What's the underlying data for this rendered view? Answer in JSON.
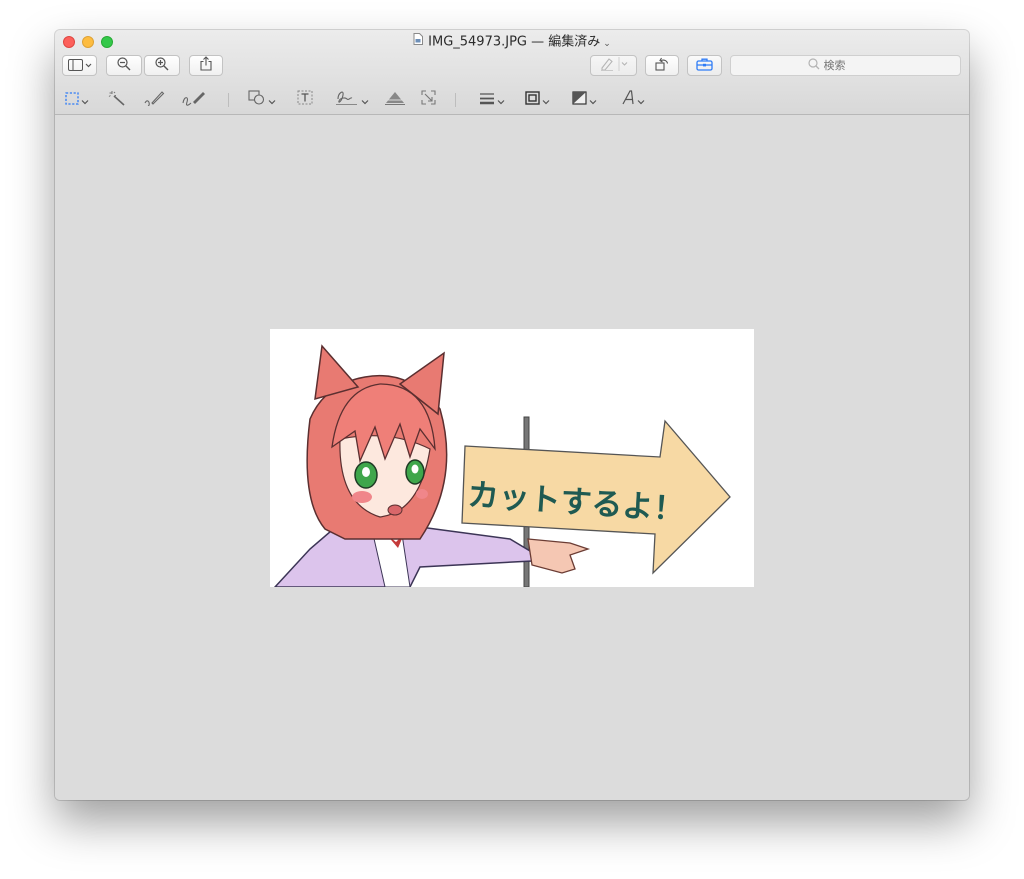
{
  "window": {
    "title": "IMG_54973.JPG",
    "title_separator": "—",
    "title_status": "編集済み",
    "file_icon": "jpeg-doc-icon"
  },
  "toolbar": {
    "sidebar_button": "sidebar-toggle-icon",
    "zoom_out": "zoom-out-icon",
    "zoom_in": "zoom-in-icon",
    "share": "share-icon",
    "highlight": "highlighter-icon",
    "rotate": "rotate-left-icon",
    "markup_toolbox": "toolbox-icon",
    "search_placeholder": "検索"
  },
  "markup_tools": [
    {
      "name": "rectangular-selection-icon",
      "has_dropdown": true
    },
    {
      "name": "instant-alpha-icon",
      "has_dropdown": false
    },
    {
      "name": "sketch-icon",
      "has_dropdown": false
    },
    {
      "name": "draw-icon",
      "has_dropdown": false
    },
    {
      "name": "shapes-icon",
      "has_dropdown": true
    },
    {
      "name": "text-icon",
      "has_dropdown": false
    },
    {
      "name": "sign-icon",
      "has_dropdown": true
    },
    {
      "name": "adjust-color-icon",
      "has_dropdown": false
    },
    {
      "name": "adjust-size-icon",
      "has_dropdown": false
    },
    {
      "name": "shape-style-icon",
      "has_dropdown": true
    },
    {
      "name": "border-color-icon",
      "has_dropdown": true
    },
    {
      "name": "fill-color-icon",
      "has_dropdown": true
    },
    {
      "name": "text-style-icon",
      "has_dropdown": true
    }
  ],
  "image": {
    "sign_text": "カットするよ！"
  },
  "colors": {
    "accent_blue": "#2f7cf6",
    "sign_fill": "#f7d9a4",
    "sign_text": "#1f5a52",
    "hair": "#ef7f78"
  }
}
